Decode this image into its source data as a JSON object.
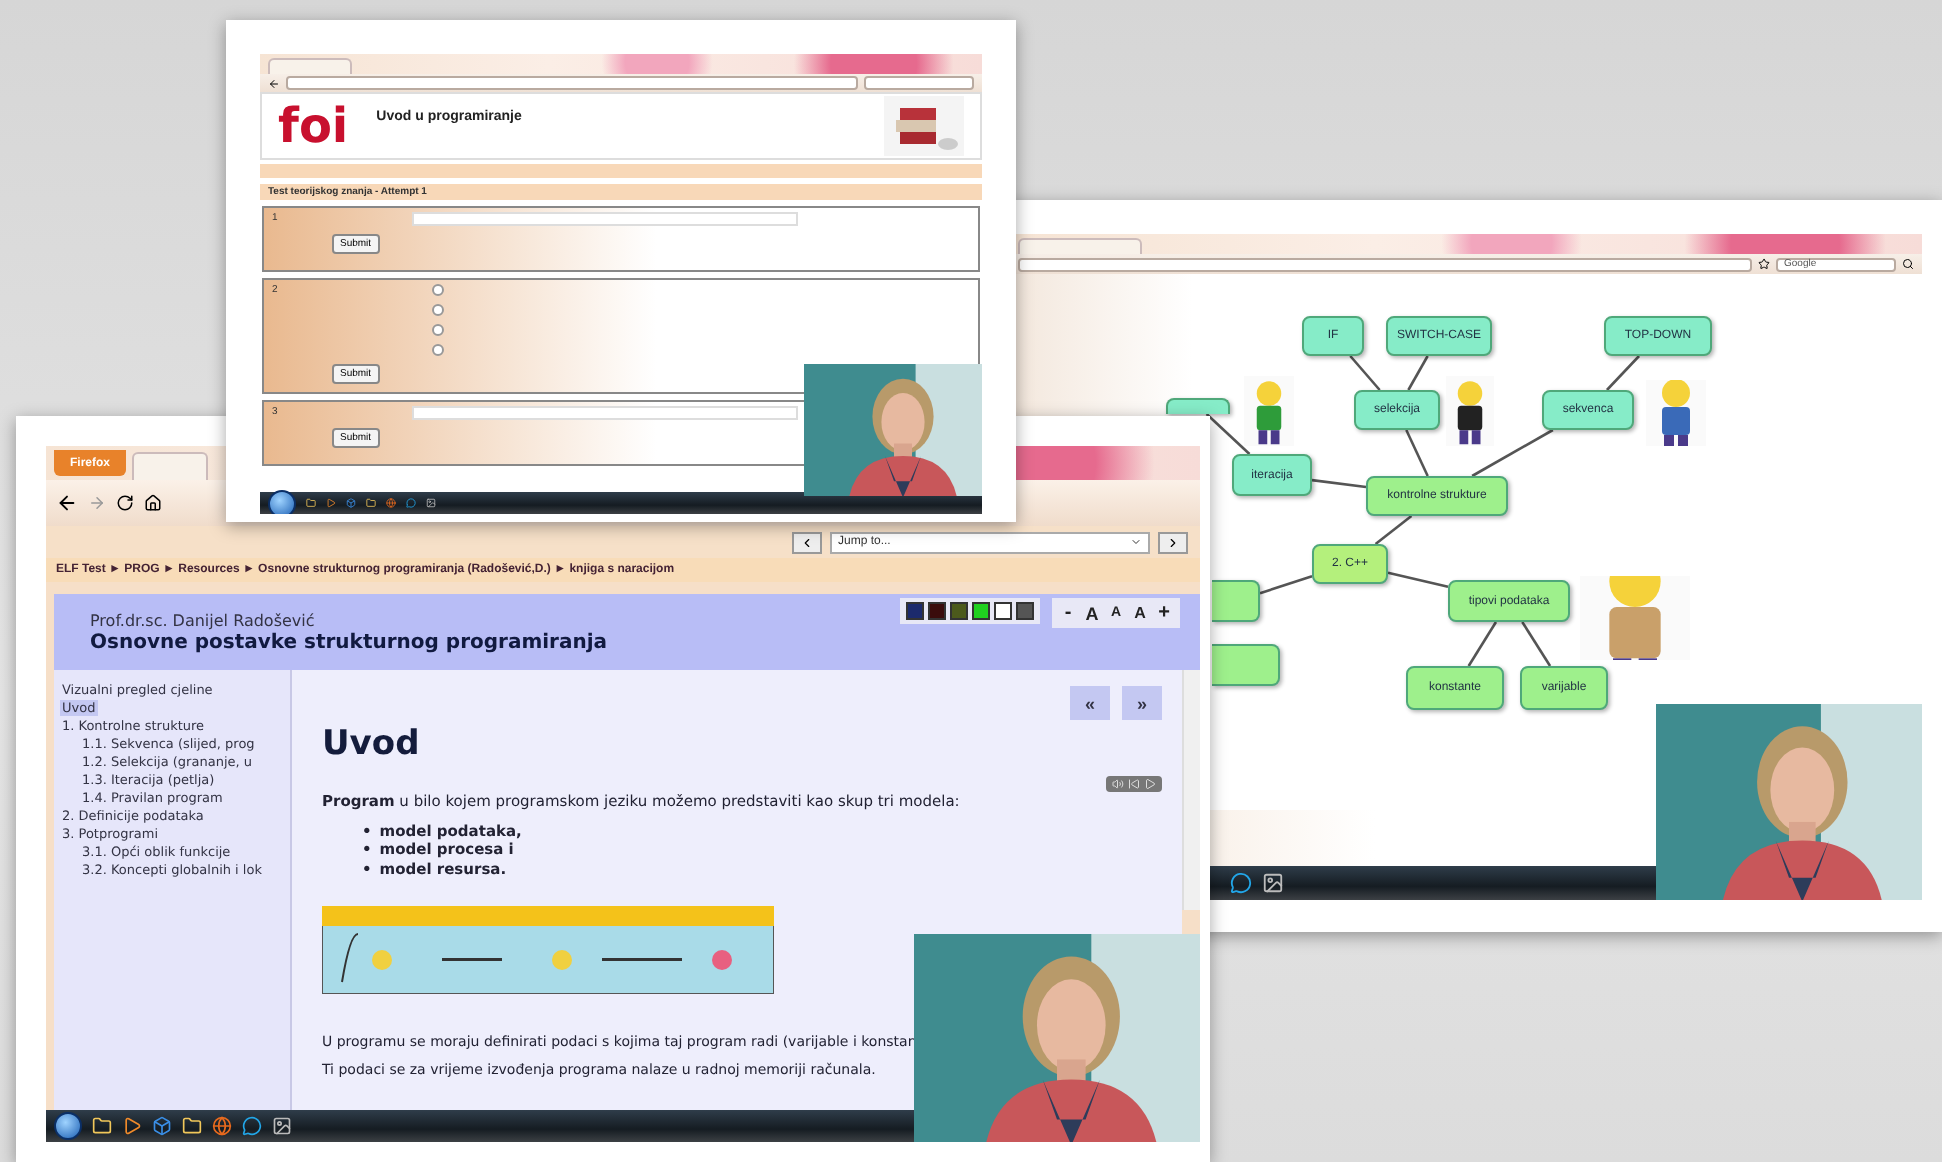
{
  "quiz_window": {
    "logo": "foi",
    "course": "Uvod u programiranje",
    "quiz_title": "Test teorijskog znanja - Attempt 1",
    "questions": [
      {
        "number": "1",
        "kind": "text",
        "button": "Submit"
      },
      {
        "number": "2",
        "kind": "choice",
        "button": "Submit",
        "options": [
          {
            "selected": false
          },
          {
            "selected": false
          },
          {
            "selected": false
          },
          {
            "selected": false
          }
        ]
      },
      {
        "number": "3",
        "kind": "text",
        "button": "Submit"
      }
    ]
  },
  "mind_map_window": {
    "search": {
      "value": "Google"
    },
    "nodes": [
      {
        "label": "IF",
        "color": "#86ecc8"
      },
      {
        "label": "SWITCH-CASE",
        "color": "#86ecc8"
      },
      {
        "label": "TOP-DOWN",
        "color": "#86ecc8"
      },
      {
        "label": "selekcija",
        "color": "#86ecc8"
      },
      {
        "label": "sekvenca",
        "color": "#86ecc8"
      },
      {
        "label": "iteracija",
        "color": "#86ecc8"
      },
      {
        "label": "kontrolne strukture",
        "color": "#9ef08c"
      },
      {
        "label": "2. C++",
        "color": "#b4f07c"
      },
      {
        "label": "tipovi podataka",
        "color": "#9ef08c"
      },
      {
        "label": "konstante",
        "color": "#9ef08c"
      },
      {
        "label": "varijable",
        "color": "#9ef08c"
      },
      {
        "color": "#86ecc8"
      },
      {
        "color": "#9ef08c"
      },
      {
        "color": "#9ef08c"
      }
    ]
  },
  "lesson_window": {
    "browser_button": "Firefox",
    "jump_menu": "Jump to...",
    "breadcrumb": "ELF Test ► PROG ► Resources ► Osnovne strukturnog programiranja (Radošević,D.) ► knjiga s naracijom",
    "author": "Prof.dr.sc. Danijel Radošević",
    "title": "Osnovne postavke strukturnog programiranja",
    "swatches": [
      {
        "color": "#1c2a6c"
      },
      {
        "color": "#3a0c0c"
      },
      {
        "color": "#4c5a1c"
      },
      {
        "color": "#20d020"
      },
      {
        "color": "#ffffff"
      },
      {
        "color": "#555555"
      }
    ],
    "font_buttons": [
      "-",
      "A",
      "A",
      "A",
      "+"
    ],
    "sidebar": {
      "items": [
        {
          "label": "Vizualni pregled cjeline",
          "selected": false
        },
        {
          "label": "Uvod",
          "selected": true
        },
        {
          "label": "1. Kontrolne strukture",
          "selected": false,
          "children": [
            {
              "label": "1.1. Sekvenca (slijed, prog",
              "selected": false
            },
            {
              "label": "1.2. Selekcija (grananje, u",
              "selected": false
            },
            {
              "label": "1.3. Iteracija (petlja)",
              "selected": false
            },
            {
              "label": "1.4. Pravilan program",
              "selected": false
            }
          ]
        },
        {
          "label": "2. Definicije podataka",
          "selected": false
        },
        {
          "label": "3. Potprogrami",
          "selected": false,
          "children": [
            {
              "label": "3.1. Opći oblik funkcije",
              "selected": false
            },
            {
              "label": "3.2. Koncepti globalnih i lok",
              "selected": false
            }
          ]
        }
      ]
    },
    "nav_buttons": [
      "«",
      "»"
    ],
    "heading": "Uvod",
    "intro": "**Program** u bilo kojem programskom jeziku možemo predstaviti kao skup tri modela:",
    "bullets": [
      {
        "marker": "•",
        "text": "model podataka,"
      },
      {
        "marker": "•",
        "text": "model procesa i"
      },
      {
        "marker": "•",
        "text": "model resursa."
      }
    ],
    "paragraphs": [
      "U programu se moraju definirati podaci s kojima taj program radi (varijable i konstan",
      "Ti podaci se za vrijeme izvođenja programa nalaze u radnoj memoriji računala."
    ]
  }
}
